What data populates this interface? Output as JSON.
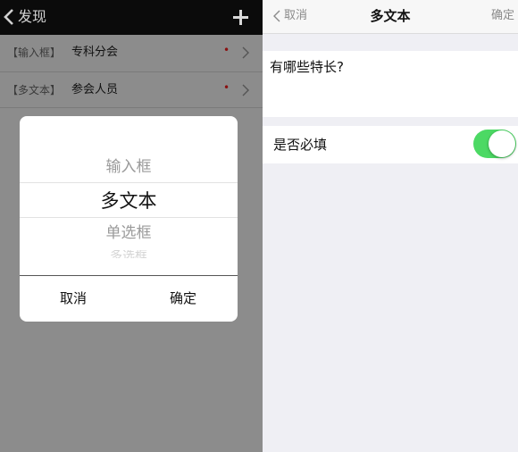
{
  "left": {
    "nav": {
      "title": "发现",
      "back_icon": "chevron-left-icon",
      "add_icon": "plus-icon"
    },
    "rows": [
      {
        "type": "【输入框】",
        "label": "专科分会",
        "required_mark": "•",
        "chevron_icon": "chevron-right-icon"
      },
      {
        "type": "【多文本】",
        "label": "参会人员",
        "required_mark": "•",
        "chevron_icon": "chevron-right-icon"
      }
    ],
    "picker": {
      "options": [
        "输入框",
        "多文本",
        "单选框",
        "多选框"
      ],
      "selected": "多文本",
      "cancel_label": "取消",
      "confirm_label": "确定"
    }
  },
  "right": {
    "nav": {
      "cancel_label": "取消",
      "title": "多文本",
      "confirm_label": "确定",
      "back_icon": "chevron-left-icon"
    },
    "question_text": "有哪些特长?",
    "required_row": {
      "label": "是否必填",
      "toggle_on": true
    }
  },
  "colors": {
    "toggle_on": "#4cd964",
    "overlay": "#8c8c8c",
    "nav_dark": "#0b0b0b"
  }
}
